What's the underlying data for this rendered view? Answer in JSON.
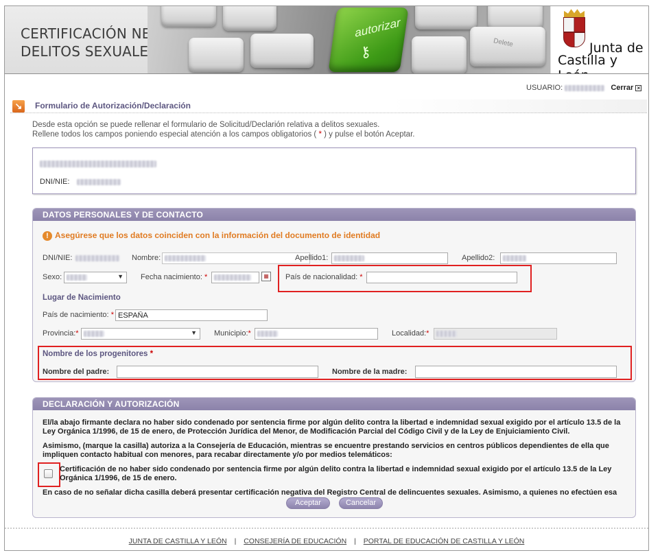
{
  "header": {
    "title": "CERTIFICACIÓN NEGATIVA DE\nDELITOS SEXUALES",
    "banner_key_label": "autorizar",
    "banner_delete_label": "Delete",
    "logo_line1": "Junta de",
    "logo_line2": "Castilla y León"
  },
  "userbar": {
    "label": "USUARIO:",
    "logout": "Cerrar"
  },
  "section": {
    "title": "Formulario de Autorización/Declaración",
    "intro_line1": "Desde esta opción se puede rellenar el formulario de Solicitud/Declarión relativa a delitos sexuales.",
    "intro_line2_a": "Rellene todos los campos poniendo especial atención a los campos obligatorios (",
    "intro_req": " * ",
    "intro_line2_b": ") y pulse el botón Aceptar."
  },
  "identity": {
    "dni_label": "DNI/NIE:"
  },
  "personal": {
    "title": "DATOS PERSONALES Y DE CONTACTO",
    "warning": "Asegúrese que los datos coinciden con la información del documento de identidad",
    "dni_label": "DNI/NIE:",
    "nombre_label": "Nombre:",
    "apellido1_label": "Apellido1:",
    "apellido2_label": "Apellido2:",
    "sexo_label": "Sexo:",
    "fecha_label": "Fecha nacimiento:",
    "pais_nac_label": "País de nacionalidad:",
    "required": "*",
    "lugar_title": "Lugar de Nacimiento",
    "pais_nacimiento_label": "País de nacimiento:",
    "pais_nacimiento_value": "ESPAÑA",
    "provincia_label": "Provincia:",
    "municipio_label": "Municipio:",
    "localidad_label": "Localidad:",
    "progenitores_title": "Nombre de los progenitores",
    "padre_label": "Nombre del padre:",
    "madre_label": "Nombre de la madre:"
  },
  "declaration": {
    "title": "DECLARACIÓN Y AUTORIZACIÓN",
    "para1": "El/la abajo firmante declara no haber sido condenado por sentencia firme por algún delito contra la libertad e indemnidad sexual exigido por el artículo 13.5 de la Ley Orgánica 1/1996, de 15 de enero, de Protección Jurídica del Menor, de Modificación Parcial del Código Civil y de la Ley de Enjuiciamiento Civil.",
    "para2": "Asimismo, (marque la casilla) autoriza a la Consejería de Educación, mientras se encuentre prestando servicios en centros públicos dependientes de ella que impliquen contacto habitual con menores, para recabar directamente y/o por medios telemáticos:",
    "checkbox_text": "Certificación de no haber sido condenado por sentencia firme por algún delito contra la libertad e indemnidad sexual exigido por el artículo 13.5 de la Ley Orgánica 1/1996, de 15 de enero.",
    "para3": "En caso de no señalar dicha casilla deberá presentar certificación negativa del Registro Central de delincuentes sexuales. Asimismo, a quienes no efectúen esa",
    "accept": "Aceptar",
    "cancel": "Cancelar"
  },
  "footer": {
    "links": [
      "JUNTA DE CASTILLA Y LEÓN",
      "CONSEJERÍA DE EDUCACIÓN",
      "PORTAL DE EDUCACIÓN DE CASTILLA Y LEÓN"
    ],
    "separator": "|"
  },
  "colors": {
    "accent": "#8c83aa",
    "warning": "#e07b22",
    "highlight": "#e02020"
  }
}
